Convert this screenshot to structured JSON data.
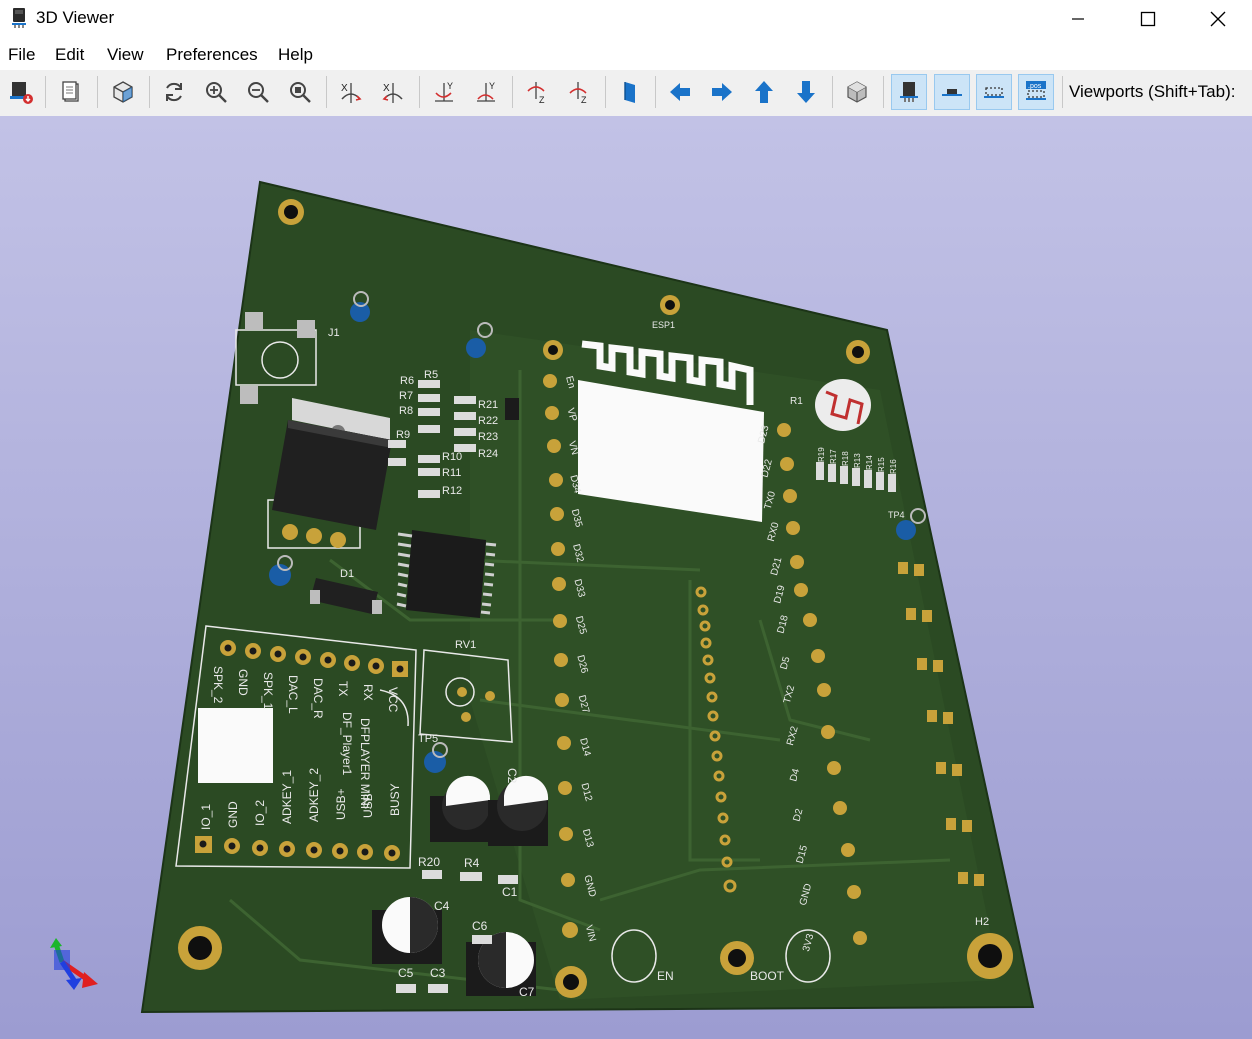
{
  "window": {
    "title": "3D Viewer"
  },
  "menu": {
    "file": "File",
    "edit": "Edit",
    "view": "View",
    "preferences": "Preferences",
    "help": "Help"
  },
  "toolbar": {
    "viewports_label": "Viewports (Shift+Tab):"
  },
  "colors": {
    "board": "#2b4a23",
    "copper": "#c8a23a",
    "silkscreen": "#e9e9e9",
    "background_top": "#c2c2e6",
    "background_bottom": "#9c9cd1",
    "accent_arrows": "#1a73c9"
  },
  "board": {
    "refs_left": {
      "j1": "J1",
      "d1": "D1",
      "rv1": "RV1",
      "tp5": "TP5",
      "r5": "R5",
      "r6": "R6",
      "r7": "R7",
      "r8": "R8",
      "r9": "R9",
      "r10": "R10",
      "r11": "R11",
      "r12": "R12",
      "r21": "R21",
      "r22": "R22",
      "r23": "R23",
      "r24": "R24",
      "r20": "R20",
      "r4": "R4",
      "c1": "C1",
      "c2": "C2",
      "c3": "C3",
      "c4": "C4",
      "c5": "C5",
      "c6": "C6",
      "c7": "C7",
      "esp1": "ESP1",
      "r1": "R1",
      "tp4": "TP4",
      "h2": "H2",
      "en": "EN",
      "boot": "BOOT"
    },
    "resistor_column": [
      "R19",
      "R17",
      "R18",
      "R13",
      "R14",
      "R15",
      "R16"
    ],
    "dfplayer": {
      "top_pins": [
        "SPK_2",
        "GND",
        "SPK_1",
        "DAC_L",
        "DAC_R",
        "TX",
        "RX",
        "VCC"
      ],
      "bottom_pins": [
        "IO_1",
        "GND",
        "IO_2",
        "ADKEY_1",
        "ADKEY_2",
        "USB+",
        "USB-",
        "BUSY"
      ],
      "name": "DFPLAYER MINI",
      "ref": "DF_Player1"
    },
    "esp_left_pins": [
      "En",
      "VP",
      "VN",
      "D34",
      "D35",
      "D32",
      "D33",
      "D25",
      "D26",
      "D27",
      "D14",
      "D12",
      "D13",
      "GND",
      "VIN"
    ],
    "esp_right_pins": [
      "D23",
      "D22",
      "TX0",
      "RX0",
      "D21",
      "D19",
      "D18",
      "D5",
      "TX2",
      "RX2",
      "D4",
      "D2",
      "D15",
      "GND",
      "3V3"
    ]
  }
}
